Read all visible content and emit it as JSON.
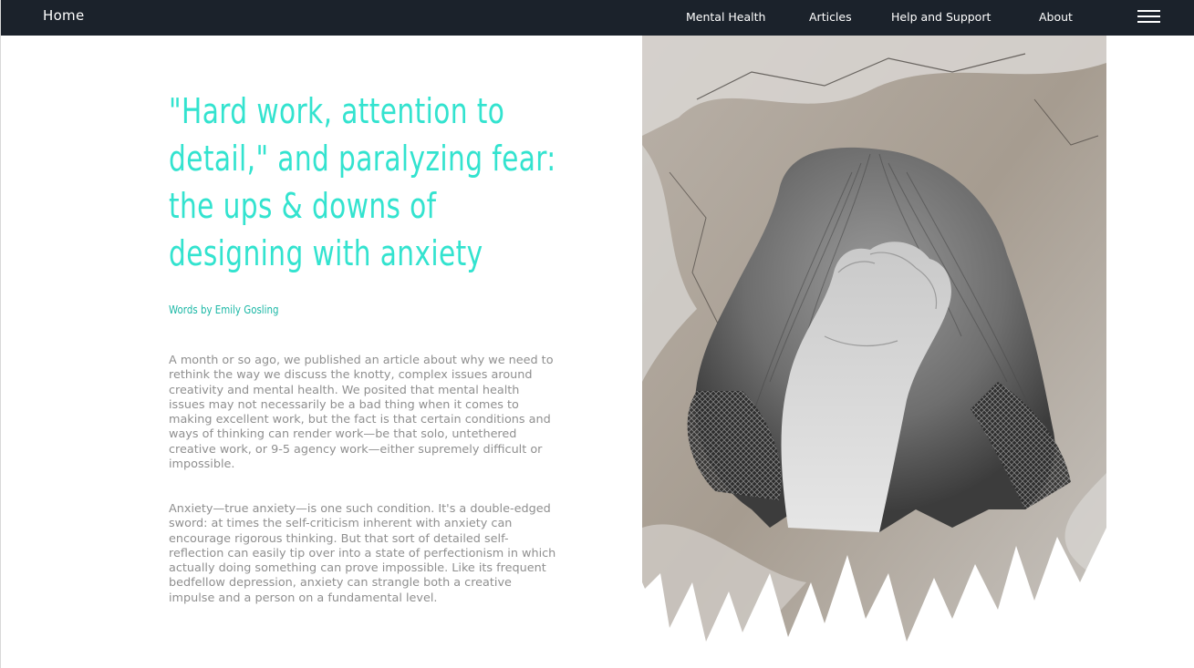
{
  "nav": {
    "home_label": "Home",
    "links": [
      "Mental Health",
      "Articles",
      "Help and Support",
      "About"
    ],
    "menu_icon": "hamburger-menu-icon"
  },
  "article": {
    "title": "\"Hard work, attention to detail,\" and paralyzing fear: the ups & downs of designing with anxiety",
    "byline": "Words by Emily Gosling",
    "paragraphs": [
      "A month or so ago, we published an article about why we need to rethink the way we discuss the knotty, complex issues around creativity and mental health. We posited that mental health issues may not necessarily be a bad thing when it comes to making excellent work, but the fact is that certain conditions and ways of thinking can render work—be that solo, untethered creative work, or 9-5 agency work—either supremely difficult or impossible.",
      "Anxiety—true anxiety—is one such condition. It's a double-edged sword: at times the self-criticism inherent with anxiety can encourage rigorous thinking. But that sort of detailed self-reflection can easily tip over into a state of perfectionism in which actually doing something can prove impossible. Like its frequent bedfellow depression, anxiety can strangle both a creative impulse and a person on a fundamental level."
    ]
  },
  "colors": {
    "nav_bg": "#1b222b",
    "accent": "#33e3cf",
    "byline": "#1cb8a6",
    "body_text": "#8f8f8f"
  }
}
